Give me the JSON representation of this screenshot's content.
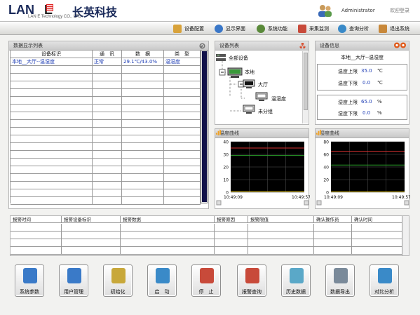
{
  "header": {
    "logo_text": "LAN",
    "logo_tail": "E",
    "logo_cn": "长英科技",
    "logo_sub": "LAN  E Technology  CO., LTD",
    "user_name": "Administrator",
    "welcome": "欢迎登录"
  },
  "nav": {
    "items": [
      {
        "label": "设备配置",
        "icon": "device-config-icon",
        "color": "#d8a23a"
      },
      {
        "label": "显示界面",
        "icon": "display-icon",
        "color": "#3a77c8"
      },
      {
        "label": "系统功能",
        "icon": "system-icon",
        "color": "#5a8a3a"
      },
      {
        "label": "采集监测",
        "icon": "monitor-icon",
        "color": "#c84a3a"
      },
      {
        "label": "查询分析",
        "icon": "query-icon",
        "color": "#3a8ac8"
      },
      {
        "label": "退出系统",
        "icon": "exit-icon",
        "color": "#c8883a"
      }
    ]
  },
  "data_panel": {
    "title": "数据显示列表",
    "columns": [
      "设备标识",
      "通　讯",
      "数　据",
      "类　型"
    ],
    "rows": [
      [
        "本地__大厅--温湿度",
        "正常",
        "29.1℃/43.0%",
        "温湿度"
      ]
    ]
  },
  "device_panel": {
    "title": "设备列表",
    "tree": {
      "root": "全部设备",
      "local": "本地",
      "hall": "大厅",
      "sensor": "温湿度",
      "ungrouped": "未分组"
    }
  },
  "info_panel": {
    "title": "设备信息",
    "device_name": "本地__大厅--温湿度",
    "temp_upper_label": "温度上限",
    "temp_upper_value": "35.0",
    "temp_lower_label": "温度下限",
    "temp_lower_value": "0.0",
    "temp_unit": "℃",
    "hum_upper_label": "湿度上限",
    "hum_upper_value": "65.0",
    "hum_lower_label": "湿度下限",
    "hum_lower_value": "0.0",
    "hum_unit": "%"
  },
  "temp_chart": {
    "title": "温度曲线",
    "y_ticks": [
      "40",
      "30",
      "20",
      "10",
      "0"
    ],
    "x_start": "10:49:09",
    "x_end": "10:49:57"
  },
  "hum_chart": {
    "title": "湿度曲线",
    "y_ticks": [
      "80",
      "60",
      "40",
      "20",
      "0"
    ],
    "x_start": "10:49:09",
    "x_end": "10:49:57"
  },
  "alarm_table": {
    "columns": [
      "报警时间",
      "报警设备标识",
      "报警数据",
      "报警原因",
      "报警限值",
      "确认操作员",
      "确认时间"
    ]
  },
  "buttons": [
    {
      "label": "系统参数",
      "icon": "tools-icon",
      "color": "#3a7ac8"
    },
    {
      "label": "用户管理",
      "icon": "user-icon",
      "color": "#3a7ac8"
    },
    {
      "label": "初始化",
      "icon": "warning-icon",
      "color": "#c8a83a"
    },
    {
      "label": "启　动",
      "icon": "start-icon",
      "color": "#3a8ac8"
    },
    {
      "label": "停　止",
      "icon": "stop-icon",
      "color": "#c84a3a"
    },
    {
      "label": "报警查询",
      "icon": "alarm-query-icon",
      "color": "#c84a3a"
    },
    {
      "label": "历史数据",
      "icon": "history-icon",
      "color": "#5aa8c8"
    },
    {
      "label": "数据导出",
      "icon": "export-icon",
      "color": "#7a8a9a"
    },
    {
      "label": "对比分析",
      "icon": "compare-icon",
      "color": "#3a8ac8"
    }
  ],
  "chart_data": [
    {
      "type": "line",
      "title": "温度曲线",
      "ylim": [
        0,
        40
      ],
      "x": [
        "10:49:09",
        "10:49:57"
      ],
      "series": [
        {
          "values": [
            35,
            35
          ],
          "color": "#d43030"
        },
        {
          "values": [
            29.1,
            29.1
          ],
          "color": "#2aa02a"
        },
        {
          "values": [
            0.6,
            0.6
          ],
          "color": "#e0c020"
        }
      ]
    },
    {
      "type": "line",
      "title": "湿度曲线",
      "ylim": [
        0,
        80
      ],
      "x": [
        "10:49:09",
        "10:49:57"
      ],
      "series": [
        {
          "values": [
            65,
            65
          ],
          "color": "#d43030"
        },
        {
          "values": [
            43,
            43
          ],
          "color": "#2aa02a"
        },
        {
          "values": [
            0.6,
            0.6
          ],
          "color": "#e0c020"
        }
      ]
    }
  ]
}
